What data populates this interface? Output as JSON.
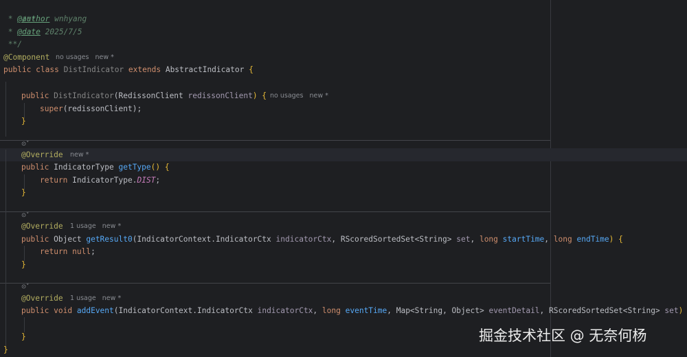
{
  "doc": {
    "open": "/**",
    "author_prefix": " * ",
    "author_tag": "@author",
    "author_value": " wnhyang",
    "date_prefix": " * ",
    "date_tag": "@date",
    "date_value": " 2025/7/5",
    "close": " **/"
  },
  "class_decl": {
    "annotation": "@Component",
    "annotation_hint": "no usages   new *",
    "kw_public": "public",
    "kw_class": "class",
    "name": "DistIndicator",
    "kw_extends": "extends",
    "parent": "AbstractIndicator",
    "brace_open": "{",
    "brace_close": "}"
  },
  "constructor": {
    "kw_public": "public",
    "name": "DistIndicator",
    "param_type": "RedissonClient",
    "param_name": "redissonClient",
    "close": ") {",
    "hint": "no usages   new *",
    "super_call": "super",
    "super_arg": "(redissonClient);",
    "end": "}"
  },
  "method_gettype": {
    "gutter": "⊙˅",
    "annotation": "@Override",
    "hint": "new *",
    "kw_public": "public",
    "return_type": "IndicatorType",
    "name": "getType",
    "parens": "() {",
    "kw_return": "return",
    "ret_class": "IndicatorType.",
    "ret_field": "DIST",
    "semi": ";",
    "end": "}"
  },
  "method_getresult": {
    "gutter": "⊙˅",
    "annotation": "@Override",
    "hint": "1 usage   new *",
    "kw_public": "public",
    "return_type": "Object",
    "name": "getResult0",
    "p1_type": "(IndicatorContext.IndicatorCtx",
    "p1_name": "indicatorCtx",
    "p2_type": ", RScoredSortedSet<String>",
    "p2_name": "set",
    "comma1": ",",
    "kw_long1": "long",
    "p3_name": "startTime",
    "comma2": ",",
    "kw_long2": "long",
    "p4_name": "endTime",
    "close": ") {",
    "kw_return": "return",
    "kw_null": "null",
    "semi": ";",
    "end": "}"
  },
  "method_addevent": {
    "gutter": "⊙˅",
    "annotation": "@Override",
    "hint": "1 usage   new *",
    "kw_public": "public",
    "kw_void": "void",
    "name": "addEvent",
    "p1_type": "(IndicatorContext.IndicatorCtx",
    "p1_name": "indicatorCtx",
    "comma1": ",",
    "kw_long": "long",
    "p2_name": "eventTime",
    "p3_type": ", Map<String, Object>",
    "p3_name": "eventDetail",
    "p4_type": ", RScoredSortedSet<String>",
    "p4_name": "set",
    "close": ") {",
    "end": "}"
  },
  "watermark": "掘金技术社区 @ 无奈何杨"
}
